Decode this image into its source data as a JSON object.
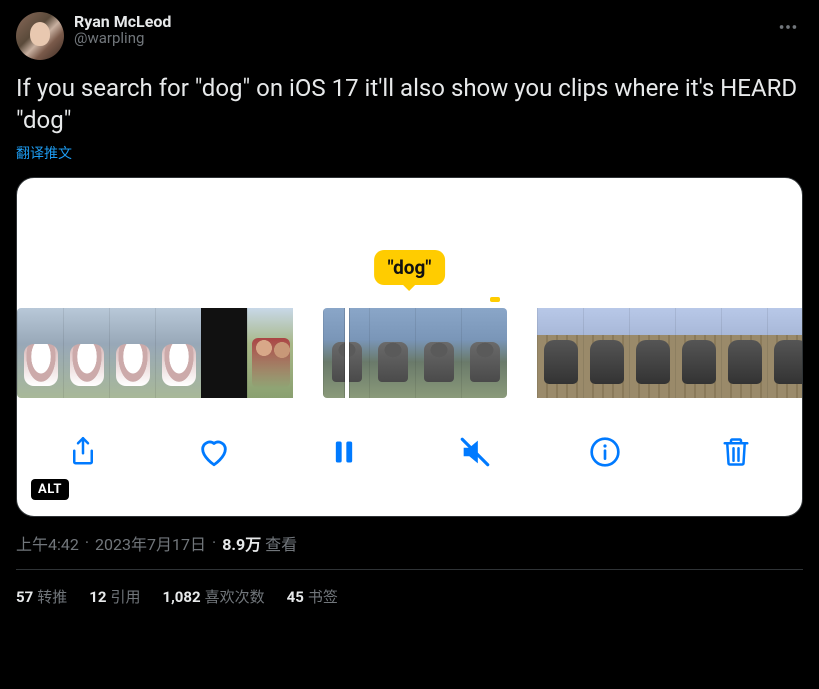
{
  "author": {
    "display_name": "Ryan McLeod",
    "handle": "@warpling"
  },
  "tweet": {
    "text": "If you search for \"dog\" on iOS 17 it'll also show you clips where it's HEARD \"dog\"",
    "translate_label": "翻译推文"
  },
  "media": {
    "alt_badge": "ALT",
    "caption_bubble": "\"dog\""
  },
  "meta": {
    "time": "上午4:42",
    "date": "2023年7月17日",
    "views_count": "8.9万",
    "views_label": "查看"
  },
  "stats": {
    "retweets": {
      "count": "57",
      "label": "转推"
    },
    "quotes": {
      "count": "12",
      "label": "引用"
    },
    "likes": {
      "count": "1,082",
      "label": "喜欢次数"
    },
    "bookmarks": {
      "count": "45",
      "label": "书签"
    }
  }
}
